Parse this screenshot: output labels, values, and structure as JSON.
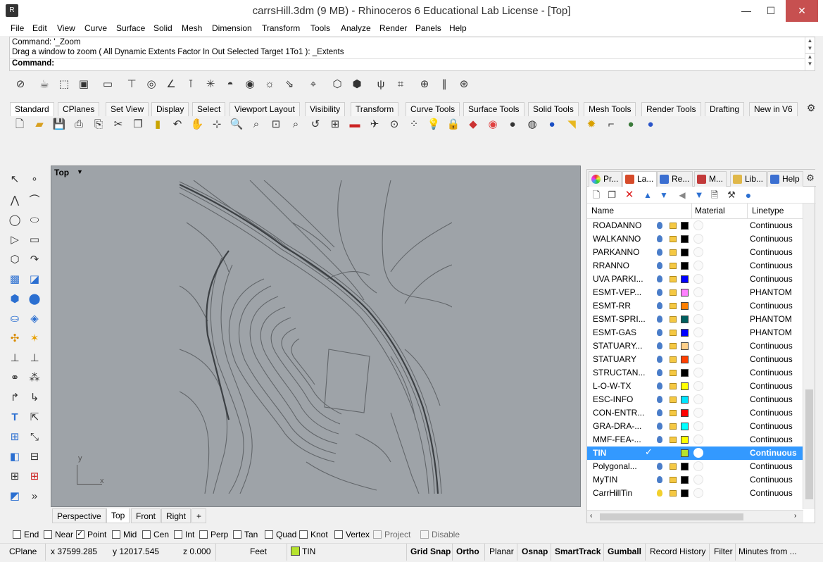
{
  "window": {
    "title": "carrsHill.3dm (9 MB) - Rhinoceros 6 Educational Lab License - [Top]",
    "minimize": "—",
    "maximize": "☐",
    "close": "✕"
  },
  "menu": [
    "File",
    "Edit",
    "View",
    "Curve",
    "Surface",
    "Solid",
    "Mesh",
    "Dimension",
    "Transform",
    "Tools",
    "Analyze",
    "Render",
    "Panels",
    "Help"
  ],
  "command": {
    "history_1": "Command: '_Zoom",
    "history_2": "Drag a window to zoom ( All  Dynamic  Extents  Factor  In  Out  Selected  Target  1To1 ): _Extents",
    "prompt": "Command:"
  },
  "toolbar_tabs": [
    "Standard",
    "CPlanes",
    "Set View",
    "Display",
    "Select",
    "Viewport Layout",
    "Visibility",
    "Transform",
    "Curve Tools",
    "Surface Tools",
    "Solid Tools",
    "Mesh Tools",
    "Render Tools",
    "Drafting",
    "New in V6"
  ],
  "viewport": {
    "label": "Top",
    "axis_y": "y",
    "axis_x": "x"
  },
  "viewport_tabs": [
    "Perspective",
    "Top",
    "Front",
    "Right"
  ],
  "viewport_add": "+",
  "panel": {
    "tabs": [
      "Pr...",
      "La...",
      "Re...",
      "M...",
      "Lib...",
      "Help"
    ],
    "columns": {
      "name": "Name",
      "material": "Material",
      "linetype": "Linetype"
    },
    "layers": [
      {
        "name": "ROADANNO",
        "color": "#000000",
        "linetype": "Continuous"
      },
      {
        "name": "WALKANNO",
        "color": "#000000",
        "linetype": "Continuous"
      },
      {
        "name": "PARKANNO",
        "color": "#000000",
        "linetype": "Continuous"
      },
      {
        "name": "RRANNO",
        "color": "#000000",
        "linetype": "Continuous"
      },
      {
        "name": "UVA PARKI...",
        "color": "#0000ff",
        "linetype": "Continuous"
      },
      {
        "name": "ESMT-VEP...",
        "color": "#ff80ff",
        "linetype": "PHANTOM"
      },
      {
        "name": "ESMT-RR",
        "color": "#ff7f00",
        "linetype": "Continuous"
      },
      {
        "name": "ESMT-SPRI...",
        "color": "#005f5f",
        "linetype": "PHANTOM"
      },
      {
        "name": "ESMT-GAS",
        "color": "#0000ff",
        "linetype": "PHANTOM"
      },
      {
        "name": "STATUARY...",
        "color": "#ffd08a",
        "linetype": "Continuous"
      },
      {
        "name": "STATUARY",
        "color": "#ff3f00",
        "linetype": "Continuous"
      },
      {
        "name": "STRUCTAN...",
        "color": "#000000",
        "linetype": "Continuous"
      },
      {
        "name": "L-O-W-TX",
        "color": "#ffff00",
        "linetype": "Continuous"
      },
      {
        "name": "ESC-INFO",
        "color": "#00e5ff",
        "linetype": "Continuous"
      },
      {
        "name": "CON-ENTR...",
        "color": "#ff0000",
        "linetype": "Continuous"
      },
      {
        "name": "GRA-DRA-...",
        "color": "#00ffff",
        "linetype": "Continuous"
      },
      {
        "name": "MMF-FEA-...",
        "color": "#ffff00",
        "linetype": "Continuous"
      },
      {
        "name": "TIN",
        "color": "#b6e32d",
        "linetype": "Continuous",
        "current": true,
        "check": "✓"
      },
      {
        "name": "Polygonal...",
        "color": "#000000",
        "linetype": "Continuous"
      },
      {
        "name": "MyTIN",
        "color": "#000000",
        "linetype": "Continuous"
      },
      {
        "name": "CarrHillTin",
        "color": "#000000",
        "linetype": "Continuous",
        "bulb_off": true
      }
    ]
  },
  "osnaps": [
    {
      "label": "End",
      "checked": false
    },
    {
      "label": "Near",
      "checked": false
    },
    {
      "label": "Point",
      "checked": true
    },
    {
      "label": "Mid",
      "checked": false
    },
    {
      "label": "Cen",
      "checked": false
    },
    {
      "label": "Int",
      "checked": false
    },
    {
      "label": "Perp",
      "checked": false
    },
    {
      "label": "Tan",
      "checked": false
    },
    {
      "label": "Quad",
      "checked": false
    },
    {
      "label": "Knot",
      "checked": false
    },
    {
      "label": "Vertex",
      "checked": false
    },
    {
      "label": "Project",
      "checked": false,
      "disabled": true
    },
    {
      "label": "Disable",
      "checked": false,
      "disabled": true
    }
  ],
  "status": {
    "cplane": "CPlane",
    "x": "x 37599.285",
    "y": "y 12017.545",
    "z": "z 0.000",
    "units": "Feet",
    "layer": "TIN",
    "grid_snap": "Grid Snap",
    "ortho": "Ortho",
    "planar": "Planar",
    "osnap": "Osnap",
    "smarttrack": "SmartTrack",
    "gumball": "Gumball",
    "record_history": "Record History",
    "filter": "Filter",
    "minutes": "Minutes from ..."
  }
}
